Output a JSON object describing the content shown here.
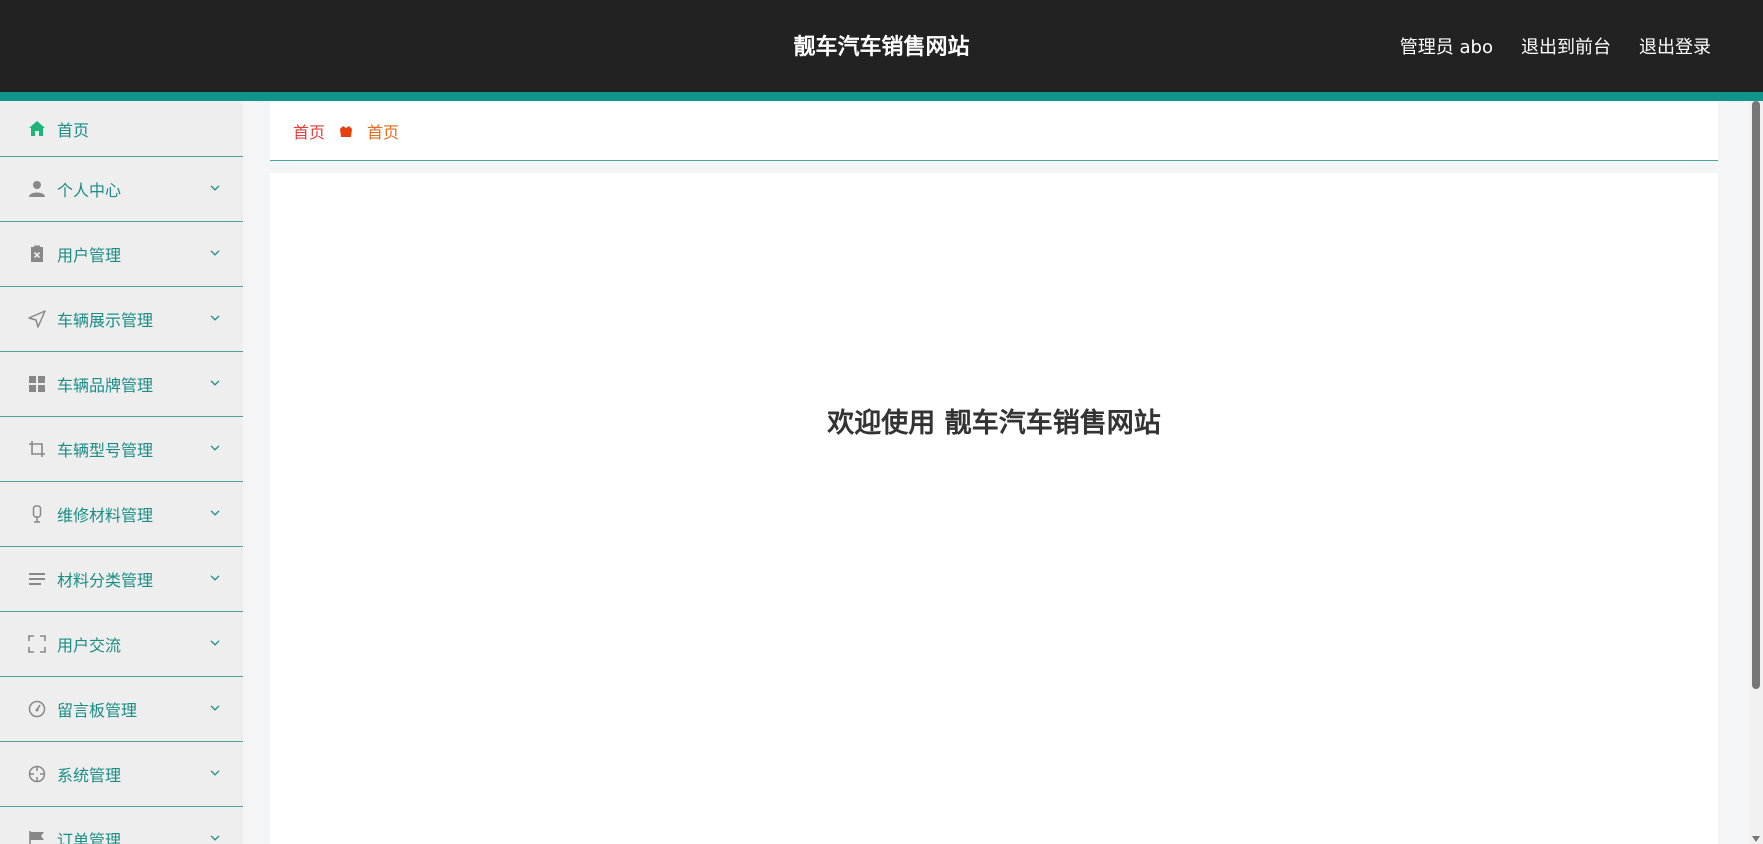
{
  "header": {
    "title": "靓车汽车销售网站",
    "user": "管理员 abo",
    "to_front": "退出到前台",
    "logout": "退出登录",
    "bg_color": "#222222",
    "accent_color": "#11958a"
  },
  "sidebar": {
    "items": [
      {
        "label": "首页",
        "icon": "home-icon"
      },
      {
        "label": "个人中心",
        "icon": "user-icon"
      },
      {
        "label": "用户管理",
        "icon": "clipboard-x-icon"
      },
      {
        "label": "车辆展示管理",
        "icon": "navigation-arrow-icon"
      },
      {
        "label": "车辆品牌管理",
        "icon": "grid-icon"
      },
      {
        "label": "车辆型号管理",
        "icon": "crop-icon"
      },
      {
        "label": "维修材料管理",
        "icon": "microphone-icon"
      },
      {
        "label": "材料分类管理",
        "icon": "list-icon"
      },
      {
        "label": "用户交流",
        "icon": "fullscreen-icon"
      },
      {
        "label": "留言板管理",
        "icon": "gauge-icon"
      },
      {
        "label": "系统管理",
        "icon": "crosshair-icon"
      },
      {
        "label": "订单管理",
        "icon": "flag-icon"
      }
    ]
  },
  "breadcrumb": {
    "home": "首页",
    "current": "首页"
  },
  "main": {
    "welcome": "欢迎使用 靓车汽车销售网站"
  }
}
